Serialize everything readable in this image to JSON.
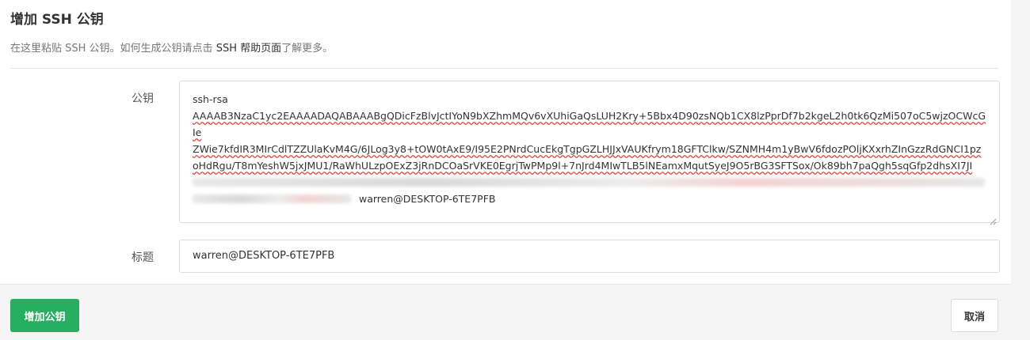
{
  "form": {
    "title": "增加 SSH 公钥",
    "description_prefix": "在这里粘贴 SSH 公钥。如何生成公钥请点击 ",
    "help_link": "SSH 帮助页面",
    "description_suffix": "了解更多。",
    "key_label": "公钥",
    "key_value": {
      "line1": "ssh-rsa",
      "line2": "AAAAB3NzaC1yc2EAAAADAQABAAABgQDicFzBlvJctIYoN9bXZhmMQv6vXUhiGaQsLUH2Kry+5Bbx4D90zsNQb1CX8lzPprDf7b2kgeL2h0tk6QzMi507oC5wjzOCWcGIe",
      "line3": "ZWie7kfdIR3MIrCdlTZZUlaKvM4G/6JLog3y8+tOW0tAxE9/I95E2PNrdCucEkgTgpGZLHJJxVAUKfrym18GFTClkw/SZNMH4m1yBwV6fdozPOljKXxrhZInGzzRdGNCI1pz",
      "line4": "oHdRgu/T8mYeshW5jxJMU1/RaWhULzpOExZ3jRnDCOaSrVKE0EgrjTwPMp9l+7nJrd4MIwTLB5lNEamxMqutSyeJ9O5rBG3SFTSox/Ok89bh7paQgh5sqGfp2dhsXI7JI",
      "tail": "warren@DESKTOP-6TE7PFB"
    },
    "title_label": "标题",
    "title_value": "warren@DESKTOP-6TE7PFB"
  },
  "actions": {
    "submit_label": "增加公钥",
    "cancel_label": "取消"
  },
  "colors": {
    "primary": "#27ae60",
    "footer_bg": "#f5f5f5",
    "border": "#dcdcdc"
  }
}
